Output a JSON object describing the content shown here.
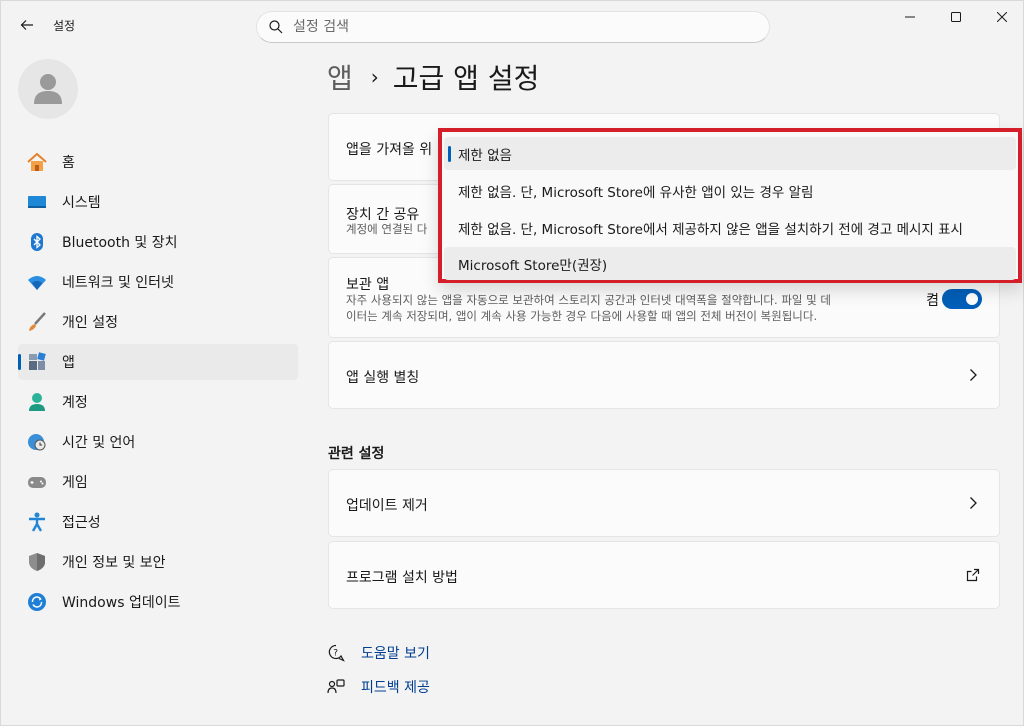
{
  "window": {
    "title": "설정",
    "search_placeholder": "설정 검색"
  },
  "sidebar": {
    "items": [
      {
        "label": "홈",
        "icon": "home-icon"
      },
      {
        "label": "시스템",
        "icon": "system-icon"
      },
      {
        "label": "Bluetooth 및 장치",
        "icon": "bluetooth-icon"
      },
      {
        "label": "네트워크 및 인터넷",
        "icon": "wifi-icon"
      },
      {
        "label": "개인 설정",
        "icon": "brush-icon"
      },
      {
        "label": "앱",
        "icon": "apps-icon",
        "active": true
      },
      {
        "label": "계정",
        "icon": "account-icon"
      },
      {
        "label": "시간 및 언어",
        "icon": "globe-clock-icon"
      },
      {
        "label": "게임",
        "icon": "gamepad-icon"
      },
      {
        "label": "접근성",
        "icon": "accessibility-icon"
      },
      {
        "label": "개인 정보 및 보안",
        "icon": "shield-icon"
      },
      {
        "label": "Windows 업데이트",
        "icon": "update-icon"
      }
    ]
  },
  "main": {
    "breadcrumb_parent": "앱",
    "breadcrumb_sep": "›",
    "page_title": "고급 앱 설정",
    "cards": {
      "get_apps_label": "앱을 가져올 위",
      "share_title": "장치 간 공유",
      "share_desc": "계정에 연결된 다",
      "archive_title": "보관 앱",
      "archive_desc_1": "자주 사용되지 않는 앱을 자동으로 보관하여 스토리지 공간과 인터넷 대역폭을 절약합니다. 파일 및 데",
      "archive_desc_2": "이터는 계속 저장되며, 앱이 계속 사용 가능한 경우 다음에 사용할 때 앱의 전체 버전이 복원됩니다.",
      "archive_toggle_label": "켬",
      "aliases": "앱 실행 별칭"
    },
    "related_heading": "관련 설정",
    "related": {
      "uninstall_updates": "업데이트 제거",
      "install_programs": "프로그램 설치 방법"
    },
    "links": {
      "help": "도움말 보기",
      "feedback": "피드백 제공"
    }
  },
  "dropdown": {
    "options": [
      "제한 없음",
      "제한 없음. 단, Microsoft Store에 유사한 앱이 있는 경우 알림",
      "제한 없음. 단, Microsoft Store에서 제공하지 않은 앱을 설치하기 전에 경고 메시지 표시",
      "Microsoft Store만(권장)"
    ],
    "selected": "제한 없음"
  },
  "colors": {
    "accent": "#005fb8",
    "highlight_border": "#d41f2b"
  }
}
